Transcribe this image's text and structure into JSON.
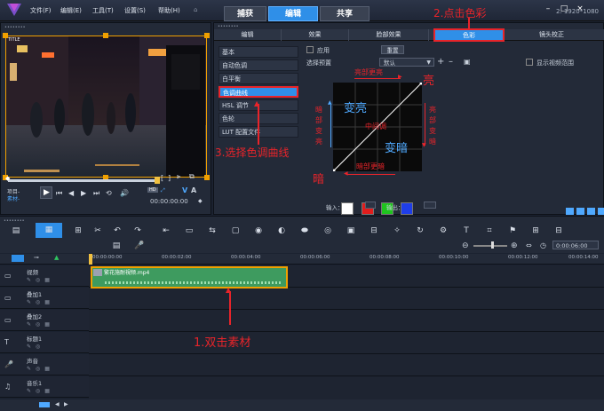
{
  "menubar": {
    "items": [
      "文件(F)",
      "编辑(E)",
      "工具(T)",
      "设置(S)",
      "帮助(H)"
    ],
    "tabs": [
      "捕获",
      "编辑",
      "共享"
    ],
    "resolution": "2. 1920*1080"
  },
  "preview": {
    "title": "TITLE",
    "project_label": "项目-",
    "clip_label": "素材-",
    "timecode": "00:00:00:00",
    "hd_badge": "HD"
  },
  "panel": {
    "subtabs": [
      "编辑",
      "效果",
      "脸部效果",
      "色彩",
      "镜头校正"
    ],
    "menu": [
      "基本",
      "自动色调",
      "白平衡",
      "色调曲线",
      "HSL 调节",
      "色轮",
      "LUT 配置文件"
    ],
    "apply_label": "应用",
    "reset_label": "重置",
    "preset_label": "选择预置",
    "preset_value": "默认",
    "show_range_label": "显示视频范围",
    "input_label": "输入：",
    "output_label": "输出："
  },
  "curve_labels": {
    "highlight_brighten": "亮部更亮",
    "bright": "亮",
    "dark_brighten": "暗部变亮",
    "brighten": "变亮",
    "midtone": "中间调",
    "darken": "变暗",
    "highlight_darken": "亮部变暗",
    "dark": "暗",
    "dark_darken": "暗部更暗"
  },
  "swatches": [
    "#ffffff",
    "#e11d1d",
    "#1fc41f",
    "#1f3ee8"
  ],
  "annotations": {
    "step1": "1.双击素材",
    "step2": "2.点击色彩",
    "step3": "3.选择色调曲线"
  },
  "timeline": {
    "ruler": [
      "00:00:00:00",
      "00:00:02:00",
      "00:00:04:00",
      "00:00:06:00",
      "00:00:08:00",
      "00:00:10:00",
      "00:00:12:00",
      "00:00:14:00"
    ],
    "zoom_time": "0:00:06:00",
    "clip_name": "繁花施耐視频.mp4",
    "tracks": [
      "视频",
      "叠加1",
      "叠加2",
      "标题1",
      "声音",
      "音乐1"
    ]
  }
}
